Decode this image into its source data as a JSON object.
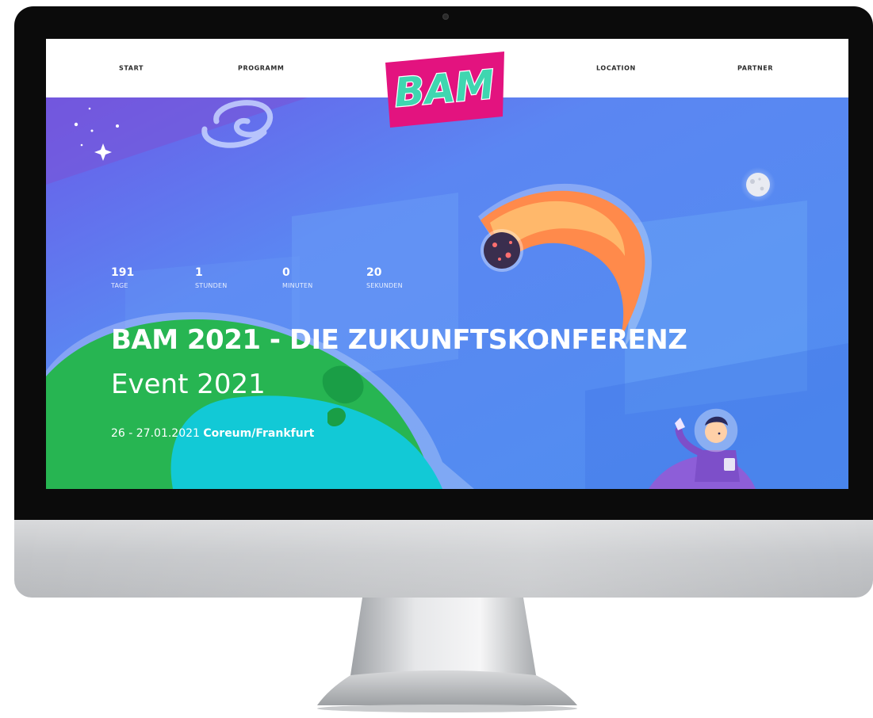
{
  "nav": {
    "start": "START",
    "programm": "PROGRAMM",
    "location": "LOCATION",
    "partner": "PARTNER"
  },
  "logo": {
    "text": "BAM"
  },
  "countdown": [
    {
      "value": "191",
      "label": "TAGE"
    },
    {
      "value": "1",
      "label": "STUNDEN"
    },
    {
      "value": "0",
      "label": "MINUTEN"
    },
    {
      "value": "20",
      "label": "SEKUNDEN"
    }
  ],
  "hero": {
    "title": "BAM 2021 - DIE ZUKUNFTSKONFERENZ",
    "subtitle": "Event 2021",
    "date": "26 - 27.01.2021",
    "location": "Coreum/Frankfurt"
  },
  "colors": {
    "hero_blue": "#5b86f2",
    "logo_magenta": "#e3137f",
    "logo_green": "#3fd6b0",
    "planet_green": "#27b552",
    "planet_cyan": "#12c9d6",
    "meteor_orange": "#ff8a4b"
  },
  "icons": [
    "galaxy-icon",
    "sparkle-stars-icon",
    "moon-icon",
    "meteor-icon",
    "planet-icon",
    "astronaut-icon"
  ]
}
